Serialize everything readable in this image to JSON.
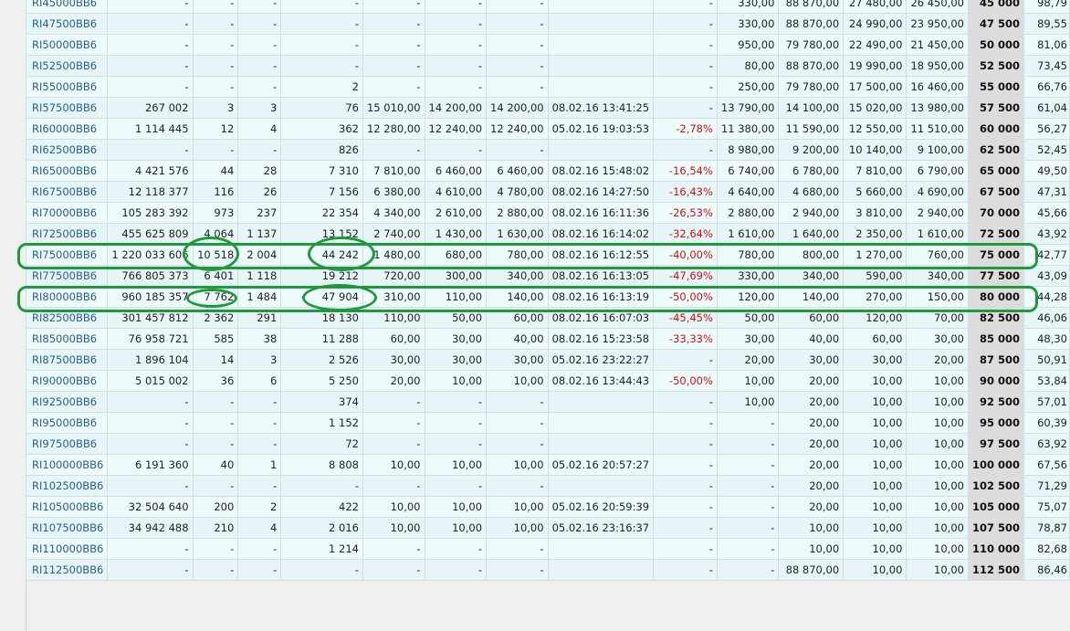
{
  "rows": [
    {
      "ticker": "RI45000BB6",
      "vol_rub": "-",
      "trades": "-",
      "c3": "-",
      "oi": "-",
      "open": "-",
      "low": "-",
      "high": "-",
      "time": "",
      "chg": "-",
      "last": "330,00",
      "theor": "88 870,00",
      "ask": "27 480,00",
      "bid": "26 450,00",
      "strike": "45 000",
      "iv": "98,79"
    },
    {
      "ticker": "RI47500BB6",
      "vol_rub": "-",
      "trades": "-",
      "c3": "-",
      "oi": "-",
      "open": "-",
      "low": "-",
      "high": "-",
      "time": "",
      "chg": "-",
      "last": "330,00",
      "theor": "88 870,00",
      "ask": "24 990,00",
      "bid": "23 950,00",
      "strike": "47 500",
      "iv": "89,55"
    },
    {
      "ticker": "RI50000BB6",
      "vol_rub": "-",
      "trades": "-",
      "c3": "-",
      "oi": "-",
      "open": "-",
      "low": "-",
      "high": "-",
      "time": "",
      "chg": "-",
      "last": "950,00",
      "theor": "79 780,00",
      "ask": "22 490,00",
      "bid": "21 450,00",
      "strike": "50 000",
      "iv": "81,06"
    },
    {
      "ticker": "RI52500BB6",
      "vol_rub": "-",
      "trades": "-",
      "c3": "-",
      "oi": "-",
      "open": "-",
      "low": "-",
      "high": "-",
      "time": "",
      "chg": "-",
      "last": "80,00",
      "theor": "88 870,00",
      "ask": "19 990,00",
      "bid": "18 950,00",
      "strike": "52 500",
      "iv": "73,45"
    },
    {
      "ticker": "RI55000BB6",
      "vol_rub": "-",
      "trades": "-",
      "c3": "-",
      "oi": "2",
      "open": "-",
      "low": "-",
      "high": "-",
      "time": "",
      "chg": "-",
      "last": "250,00",
      "theor": "79 780,00",
      "ask": "17 500,00",
      "bid": "16 460,00",
      "strike": "55 000",
      "iv": "66,76"
    },
    {
      "ticker": "RI57500BB6",
      "vol_rub": "267 002",
      "trades": "3",
      "c3": "3",
      "oi": "76",
      "open": "15 010,00",
      "low": "14 200,00",
      "high": "14 200,00",
      "time": "08.02.16 13:41:25",
      "chg": "-",
      "last": "13 790,00",
      "theor": "14 100,00",
      "ask": "15 020,00",
      "bid": "13 980,00",
      "strike": "57 500",
      "iv": "61,04"
    },
    {
      "ticker": "RI60000BB6",
      "vol_rub": "1 114 445",
      "trades": "12",
      "c3": "4",
      "oi": "362",
      "open": "12 280,00",
      "low": "12 240,00",
      "high": "12 240,00",
      "time": "05.02.16 19:03:53",
      "chg": "-2,78%",
      "last": "11 380,00",
      "theor": "11 590,00",
      "ask": "12 550,00",
      "bid": "11 510,00",
      "strike": "60 000",
      "iv": "56,27"
    },
    {
      "ticker": "RI62500BB6",
      "vol_rub": "-",
      "trades": "-",
      "c3": "-",
      "oi": "826",
      "open": "-",
      "low": "-",
      "high": "-",
      "time": "",
      "chg": "-",
      "last": "8 980,00",
      "theor": "9 200,00",
      "ask": "10 140,00",
      "bid": "9 100,00",
      "strike": "62 500",
      "iv": "52,45"
    },
    {
      "ticker": "RI65000BB6",
      "vol_rub": "4 421 576",
      "trades": "44",
      "c3": "28",
      "oi": "7 310",
      "open": "7 810,00",
      "low": "6 460,00",
      "high": "6 460,00",
      "time": "08.02.16 15:48:02",
      "chg": "-16,54%",
      "last": "6 740,00",
      "theor": "6 780,00",
      "ask": "7 810,00",
      "bid": "6 790,00",
      "strike": "65 000",
      "iv": "49,50"
    },
    {
      "ticker": "RI67500BB6",
      "vol_rub": "12 118 377",
      "trades": "116",
      "c3": "26",
      "oi": "7 156",
      "open": "6 380,00",
      "low": "4 610,00",
      "high": "4 780,00",
      "time": "08.02.16 14:27:50",
      "chg": "-16,43%",
      "last": "4 640,00",
      "theor": "4 680,00",
      "ask": "5 660,00",
      "bid": "4 690,00",
      "strike": "67 500",
      "iv": "47,31"
    },
    {
      "ticker": "RI70000BB6",
      "vol_rub": "105 283 392",
      "trades": "973",
      "c3": "237",
      "oi": "22 354",
      "open": "4 340,00",
      "low": "2 610,00",
      "high": "2 880,00",
      "time": "08.02.16 16:11:36",
      "chg": "-26,53%",
      "last": "2 880,00",
      "theor": "2 940,00",
      "ask": "3 810,00",
      "bid": "2 940,00",
      "strike": "70 000",
      "iv": "45,66"
    },
    {
      "ticker": "RI72500BB6",
      "vol_rub": "455 625 809",
      "trades": "4 064",
      "c3": "1 137",
      "oi": "13 152",
      "open": "2 740,00",
      "low": "1 430,00",
      "high": "1 630,00",
      "time": "08.02.16 16:14:02",
      "chg": "-32,64%",
      "last": "1 610,00",
      "theor": "1 640,00",
      "ask": "2 350,00",
      "bid": "1 610,00",
      "strike": "72 500",
      "iv": "43,92"
    },
    {
      "ticker": "RI75000BB6",
      "vol_rub": "1 220 033 606",
      "trades": "10 518",
      "c3": "2 004",
      "oi": "44 242",
      "open": "1 480,00",
      "low": "680,00",
      "high": "780,00",
      "time": "08.02.16 16:12:55",
      "chg": "-40,00%",
      "last": "780,00",
      "theor": "800,00",
      "ask": "1 270,00",
      "bid": "760,00",
      "strike": "75 000",
      "iv": "42,77"
    },
    {
      "ticker": "RI77500BB6",
      "vol_rub": "766 805 373",
      "trades": "6 401",
      "c3": "1 118",
      "oi": "19 212",
      "open": "720,00",
      "low": "300,00",
      "high": "340,00",
      "time": "08.02.16 16:13:05",
      "chg": "-47,69%",
      "last": "330,00",
      "theor": "340,00",
      "ask": "590,00",
      "bid": "340,00",
      "strike": "77 500",
      "iv": "43,09"
    },
    {
      "ticker": "RI80000BB6",
      "vol_rub": "960 185 357",
      "trades": "7 762",
      "c3": "1 484",
      "oi": "47 904",
      "open": "310,00",
      "low": "110,00",
      "high": "140,00",
      "time": "08.02.16 16:13:19",
      "chg": "-50,00%",
      "last": "120,00",
      "theor": "140,00",
      "ask": "270,00",
      "bid": "150,00",
      "strike": "80 000",
      "iv": "44,28"
    },
    {
      "ticker": "RI82500BB6",
      "vol_rub": "301 457 812",
      "trades": "2 362",
      "c3": "291",
      "oi": "18 130",
      "open": "110,00",
      "low": "50,00",
      "high": "60,00",
      "time": "08.02.16 16:07:03",
      "chg": "-45,45%",
      "last": "50,00",
      "theor": "60,00",
      "ask": "120,00",
      "bid": "70,00",
      "strike": "82 500",
      "iv": "46,06"
    },
    {
      "ticker": "RI85000BB6",
      "vol_rub": "76 958 721",
      "trades": "585",
      "c3": "38",
      "oi": "11 288",
      "open": "60,00",
      "low": "30,00",
      "high": "40,00",
      "time": "08.02.16 15:23:58",
      "chg": "-33,33%",
      "last": "30,00",
      "theor": "40,00",
      "ask": "60,00",
      "bid": "30,00",
      "strike": "85 000",
      "iv": "48,30"
    },
    {
      "ticker": "RI87500BB6",
      "vol_rub": "1 896 104",
      "trades": "14",
      "c3": "3",
      "oi": "2 526",
      "open": "30,00",
      "low": "30,00",
      "high": "30,00",
      "time": "05.02.16 23:22:27",
      "chg": "-",
      "last": "20,00",
      "theor": "30,00",
      "ask": "30,00",
      "bid": "20,00",
      "strike": "87 500",
      "iv": "50,91"
    },
    {
      "ticker": "RI90000BB6",
      "vol_rub": "5 015 002",
      "trades": "36",
      "c3": "6",
      "oi": "5 250",
      "open": "20,00",
      "low": "10,00",
      "high": "10,00",
      "time": "08.02.16 13:44:43",
      "chg": "-50,00%",
      "last": "10,00",
      "theor": "20,00",
      "ask": "10,00",
      "bid": "10,00",
      "strike": "90 000",
      "iv": "53,84"
    },
    {
      "ticker": "RI92500BB6",
      "vol_rub": "-",
      "trades": "-",
      "c3": "-",
      "oi": "374",
      "open": "-",
      "low": "-",
      "high": "-",
      "time": "",
      "chg": "-",
      "last": "10,00",
      "theor": "20,00",
      "ask": "10,00",
      "bid": "10,00",
      "strike": "92 500",
      "iv": "57,01"
    },
    {
      "ticker": "RI95000BB6",
      "vol_rub": "-",
      "trades": "-",
      "c3": "-",
      "oi": "1 152",
      "open": "-",
      "low": "-",
      "high": "-",
      "time": "",
      "chg": "-",
      "last": "-",
      "theor": "20,00",
      "ask": "10,00",
      "bid": "10,00",
      "strike": "95 000",
      "iv": "60,39"
    },
    {
      "ticker": "RI97500BB6",
      "vol_rub": "-",
      "trades": "-",
      "c3": "-",
      "oi": "72",
      "open": "-",
      "low": "-",
      "high": "-",
      "time": "",
      "chg": "-",
      "last": "-",
      "theor": "20,00",
      "ask": "10,00",
      "bid": "10,00",
      "strike": "97 500",
      "iv": "63,92"
    },
    {
      "ticker": "RI100000BB6",
      "vol_rub": "6 191 360",
      "trades": "40",
      "c3": "1",
      "oi": "8 808",
      "open": "10,00",
      "low": "10,00",
      "high": "10,00",
      "time": "05.02.16 20:57:27",
      "chg": "-",
      "last": "-",
      "theor": "20,00",
      "ask": "10,00",
      "bid": "10,00",
      "strike": "100 000",
      "iv": "67,56"
    },
    {
      "ticker": "RI102500BB6",
      "vol_rub": "-",
      "trades": "-",
      "c3": "-",
      "oi": "-",
      "open": "-",
      "low": "-",
      "high": "-",
      "time": "",
      "chg": "-",
      "last": "-",
      "theor": "20,00",
      "ask": "10,00",
      "bid": "10,00",
      "strike": "102 500",
      "iv": "71,29"
    },
    {
      "ticker": "RI105000BB6",
      "vol_rub": "32 504 640",
      "trades": "200",
      "c3": "2",
      "oi": "422",
      "open": "10,00",
      "low": "10,00",
      "high": "10,00",
      "time": "05.02.16 20:59:39",
      "chg": "-",
      "last": "-",
      "theor": "20,00",
      "ask": "10,00",
      "bid": "10,00",
      "strike": "105 000",
      "iv": "75,07"
    },
    {
      "ticker": "RI107500BB6",
      "vol_rub": "34 942 488",
      "trades": "210",
      "c3": "4",
      "oi": "2 016",
      "open": "10,00",
      "low": "10,00",
      "high": "10,00",
      "time": "05.02.16 23:16:37",
      "chg": "-",
      "last": "-",
      "theor": "10,00",
      "ask": "10,00",
      "bid": "10,00",
      "strike": "107 500",
      "iv": "78,87"
    },
    {
      "ticker": "RI110000BB6",
      "vol_rub": "-",
      "trades": "-",
      "c3": "-",
      "oi": "1 214",
      "open": "-",
      "low": "-",
      "high": "-",
      "time": "",
      "chg": "-",
      "last": "-",
      "theor": "10,00",
      "ask": "10,00",
      "bid": "10,00",
      "strike": "110 000",
      "iv": "82,68"
    },
    {
      "ticker": "RI112500BB6",
      "vol_rub": "-",
      "trades": "-",
      "c3": "-",
      "oi": "-",
      "open": "-",
      "low": "-",
      "high": "-",
      "time": "",
      "chg": "-",
      "last": "-",
      "theor": "88 870,00",
      "ask": "10,00",
      "bid": "10,00",
      "strike": "112 500",
      "iv": "86,46"
    }
  ]
}
